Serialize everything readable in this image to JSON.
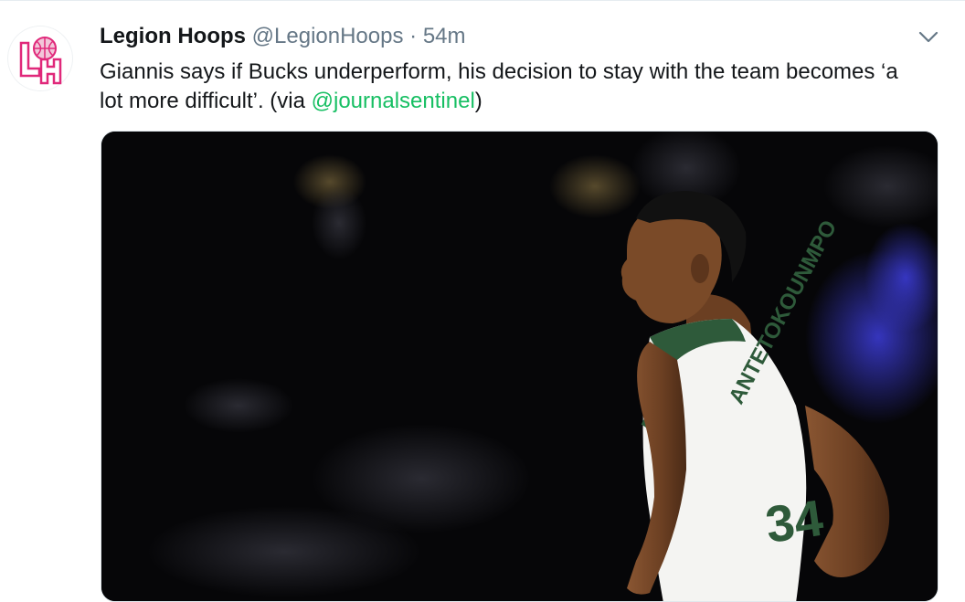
{
  "tweet": {
    "author_name": "Legion Hoops",
    "handle": "@LegionHoops",
    "separator": "·",
    "time": "54m",
    "text_before_mention": "Giannis says if Bucks underperform, his decision to stay with the team becomes ‘a lot more difficult’. (via ",
    "mention": "@journalsentinel",
    "text_after_mention": ")",
    "avatar_initials": "LH",
    "menu_icon": "chevron-down-icon",
    "jersey_name": "ANTETOKOUNMPO",
    "jersey_number": "34"
  },
  "colors": {
    "brand_pink": "#e0287a",
    "mention_green": "#17bf63",
    "meta_gray": "#657786",
    "jersey_green": "#2e5a3a"
  }
}
